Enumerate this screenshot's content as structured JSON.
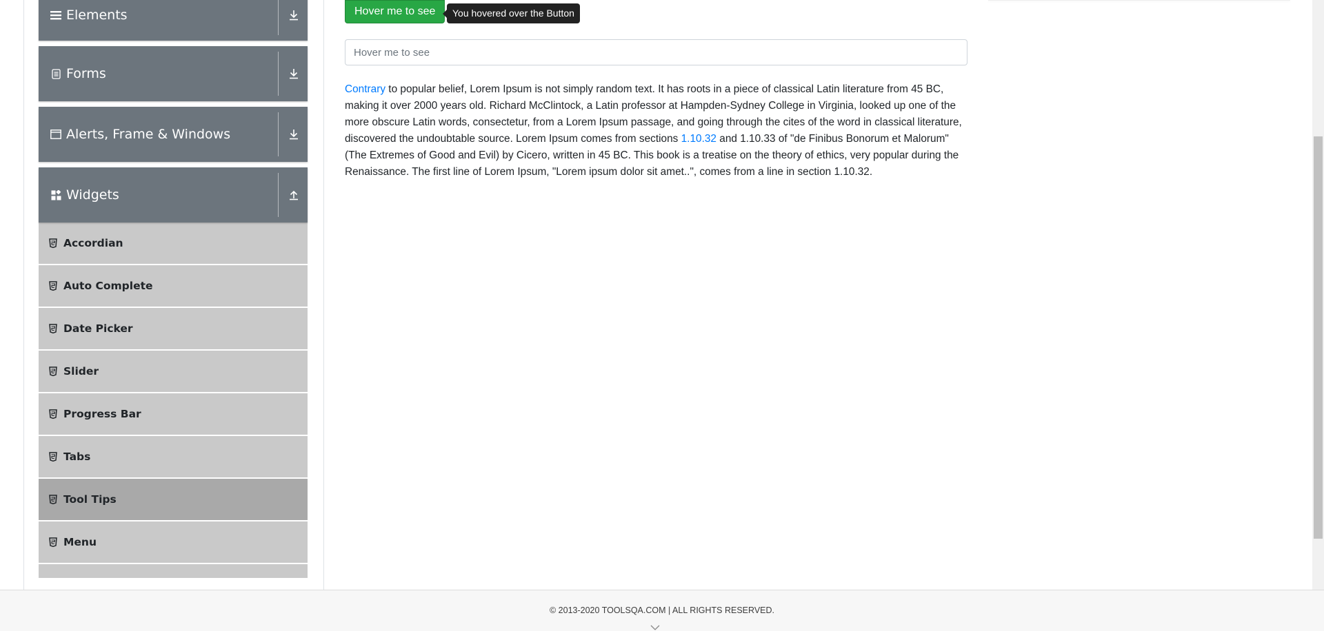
{
  "sidebar": {
    "groups": [
      {
        "label": "Elements",
        "icon": "hamburger-icon"
      },
      {
        "label": "Forms",
        "icon": "document-icon"
      },
      {
        "label": "Alerts, Frame & Windows",
        "icon": "window-icon"
      },
      {
        "label": "Widgets",
        "icon": "widgets-icon"
      }
    ],
    "items": [
      {
        "label": "Accordian"
      },
      {
        "label": "Auto Complete"
      },
      {
        "label": "Date Picker"
      },
      {
        "label": "Slider"
      },
      {
        "label": "Progress Bar"
      },
      {
        "label": "Tabs"
      },
      {
        "label": "Tool Tips",
        "active": true
      },
      {
        "label": "Menu"
      }
    ]
  },
  "main": {
    "button_label": "Hover me to see",
    "tooltip_text": "You hovered over the Button",
    "input_placeholder": "Hover me to see",
    "paragraph": {
      "link1": "Contrary",
      "text1": " to popular belief, Lorem Ipsum is not simply random text. It has roots in a piece of classical Latin literature from 45 BC, making it over 2000 years old. Richard McClintock, a Latin professor at Hampden-Sydney College in Virginia, looked up one of the more obscure Latin words, consectetur, from a Lorem Ipsum passage, and going through the cites of the word in classical literature, discovered the undoubtable source. Lorem Ipsum comes from sections ",
      "link2": "1.10.32",
      "text2": " and 1.10.33 of \"de Finibus Bonorum et Malorum\" (The Extremes of Good and Evil) by Cicero, written in 45 BC. This book is a treatise on the theory of ethics, very popular during the Renaissance. The first line of Lorem Ipsum, \"Lorem ipsum dolor sit amet..\", comes from a line in section 1.10.32."
    }
  },
  "footer": {
    "copyright": "© 2013-2020 TOOLSQA.COM | ALL RIGHTS RESERVED."
  },
  "colors": {
    "group_header_bg": "#6c757d",
    "menu_item_bg": "#c9c9c9",
    "menu_item_active_bg": "#a9a9a9",
    "button_green": "#28a745",
    "link_blue": "#007bff",
    "tooltip_bg": "#222222"
  }
}
